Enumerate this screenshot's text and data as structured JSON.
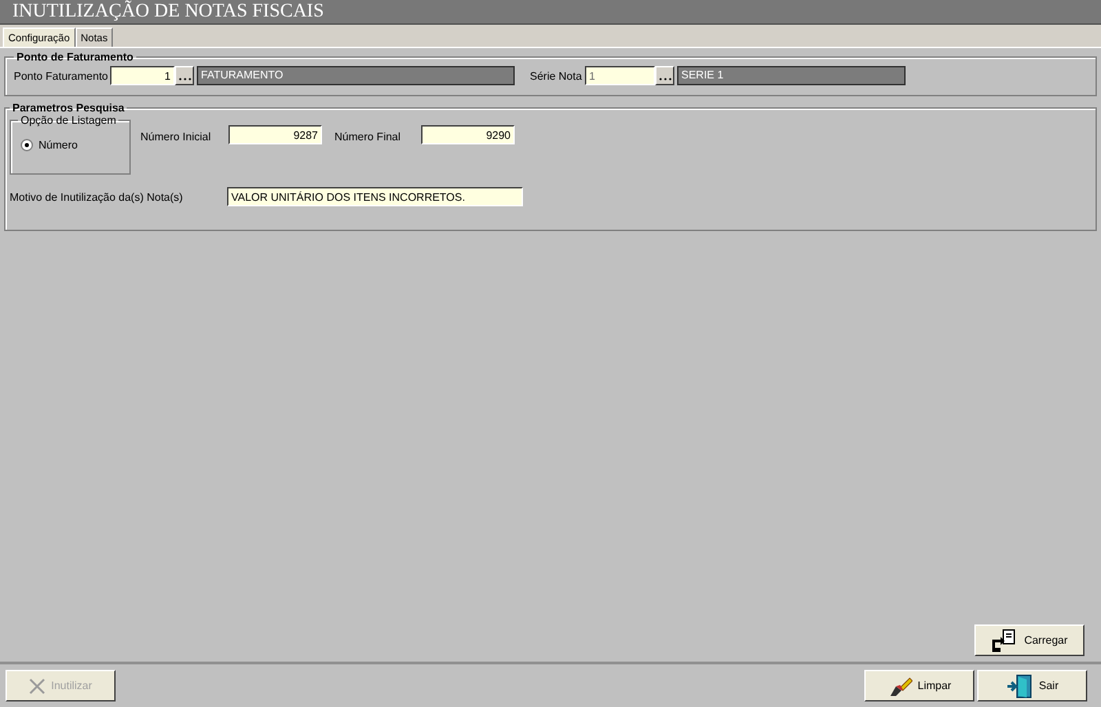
{
  "window": {
    "title": "INUTILIZAÇÃO DE NOTAS FISCAIS"
  },
  "tabs": [
    {
      "label": "Configuração",
      "selected": true
    },
    {
      "label": "Notas",
      "selected": false
    }
  ],
  "ponto_faturamento": {
    "title": "Ponto de Faturamento",
    "fields": [
      {
        "label": "Ponto Faturamento",
        "value": "1",
        "description": "FATURAMENTO",
        "disabled": false
      },
      {
        "label": "Série Nota",
        "value": "1",
        "description": "SERIE 1",
        "disabled": true
      }
    ]
  },
  "parametros_pesquisa": {
    "title": "Parametros Pesquisa",
    "opcao_listagem": {
      "title": "Opção de Listagem",
      "options": [
        {
          "label": "Número",
          "selected": true
        }
      ]
    },
    "numero_inicial": {
      "label": "Número Inicial",
      "value": "9287"
    },
    "numero_final": {
      "label": "Número Final",
      "value": "9290"
    },
    "motivo": {
      "label": "Motivo de Inutilização da(s) Nota(s)",
      "value": "VALOR UNITÁRIO DOS ITENS INCORRETOS."
    }
  },
  "buttons": [
    {
      "kind": "carregar",
      "label": "Carregar",
      "disabled": false
    },
    {
      "kind": "inutilizar",
      "label": "Inutilizar",
      "disabled": true
    },
    {
      "kind": "limpar",
      "label": "Limpar",
      "disabled": false
    },
    {
      "kind": "sair",
      "label": "Sair",
      "disabled": false
    }
  ]
}
